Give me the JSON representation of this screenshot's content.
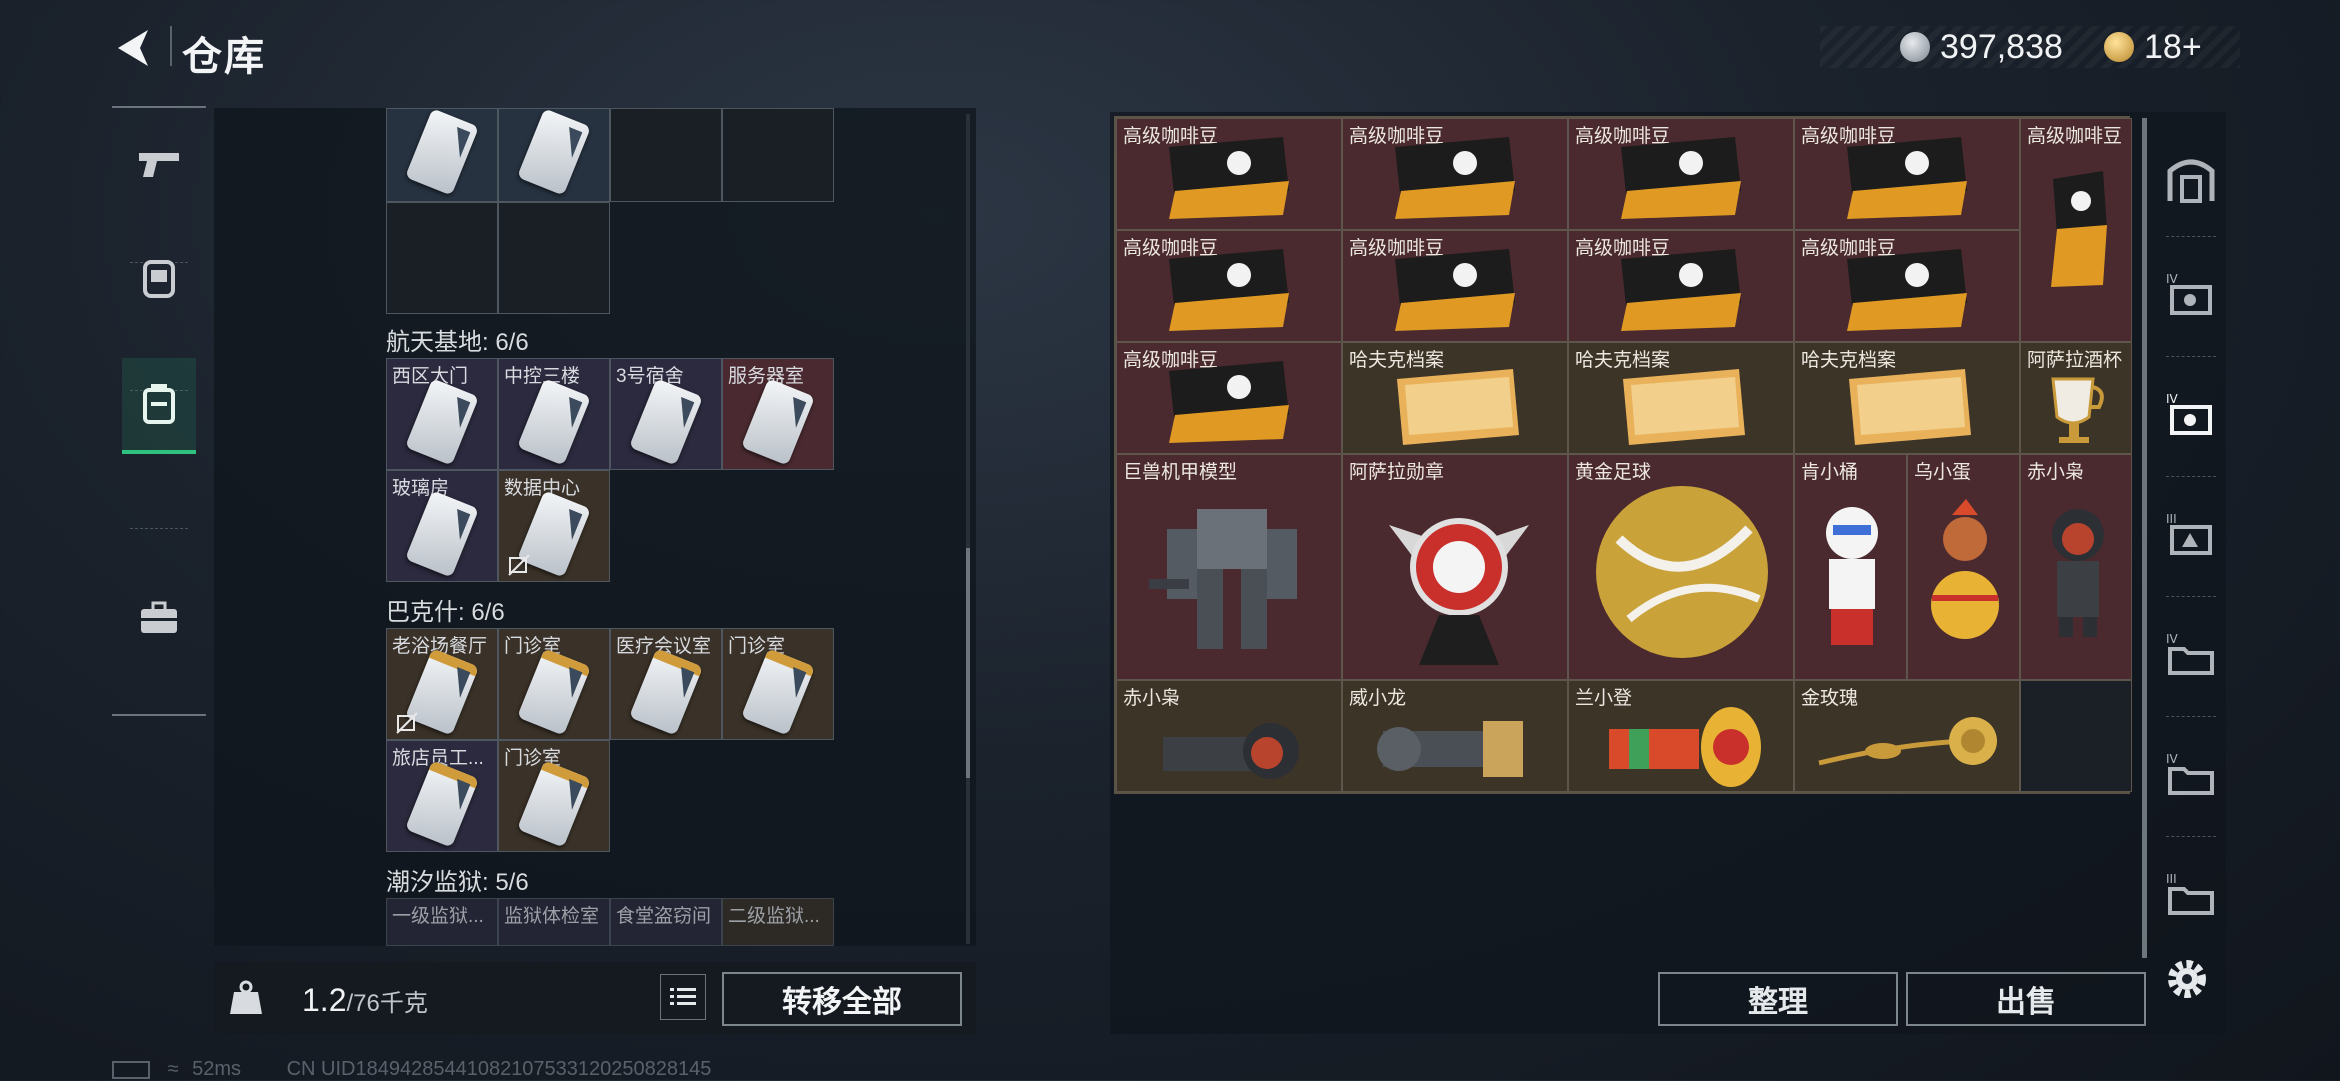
{
  "header": {
    "title": "仓库",
    "currency1": "397,838",
    "currency2": "18+"
  },
  "sidebar": {
    "items": [
      {
        "icon": "pistol-icon",
        "active": false
      },
      {
        "icon": "armor-icon",
        "active": false
      },
      {
        "icon": "backpack-icon",
        "active": true
      },
      {
        "icon": "briefcase-icon",
        "active": false
      }
    ]
  },
  "left": {
    "sections": [
      {
        "title": "航天基地: 6/6",
        "items": [
          "西区大门",
          "中控三楼",
          "3号宿舍",
          "服务器室",
          "玻璃房",
          "数据中心"
        ]
      },
      {
        "title": "巴克什: 6/6",
        "items": [
          "老浴场餐厅",
          "门诊室",
          "医疗会议室",
          "门诊室",
          "旅店员工...",
          "门诊室"
        ]
      },
      {
        "title": "潮汐监狱: 5/6",
        "items": [
          "一级监狱...",
          "监狱体检室",
          "食堂盗窃间",
          "二级监狱..."
        ]
      }
    ],
    "weight": {
      "value": "1.2",
      "max": "/76千克"
    },
    "transfer_label": "转移全部"
  },
  "right": {
    "items": [
      "高级咖啡豆",
      "高级咖啡豆",
      "高级咖啡豆",
      "高级咖啡豆",
      "高级咖啡豆",
      "高级咖啡豆",
      "高级咖啡豆",
      "高级咖啡豆",
      "高级咖啡豆",
      "高级咖啡豆",
      "哈夫克档案",
      "哈夫克档案",
      "哈夫克档案",
      "阿萨拉酒杯",
      "巨兽机甲模型",
      "阿萨拉勋章",
      "黄金足球",
      "肯小桶",
      "乌小蛋",
      "赤小枭",
      "赤小枭",
      "威小龙",
      "兰小登",
      "金玫瑰"
    ],
    "sort_label": "整理",
    "sell_label": "出售"
  },
  "status": {
    "ping": "52ms",
    "uid": "CN UID18494285441082107533120250828145"
  },
  "colors": {
    "accent": "#2ec27e",
    "item_red": "#4a2a2e",
    "item_brown": "#3d3428"
  }
}
